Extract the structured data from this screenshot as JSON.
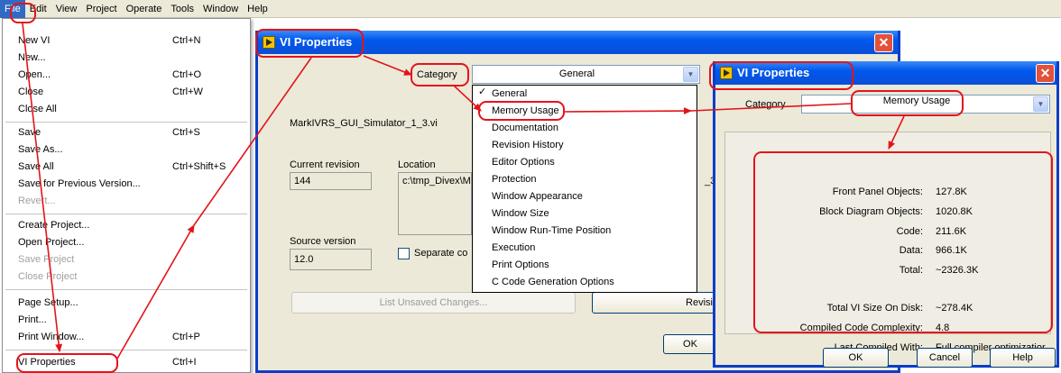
{
  "menubar": [
    "File",
    "Edit",
    "View",
    "Project",
    "Operate",
    "Tools",
    "Window",
    "Help"
  ],
  "file_menu": [
    {
      "label": "New VI",
      "shortcut": "Ctrl+N"
    },
    {
      "label": "New...",
      "shortcut": ""
    },
    {
      "label": "Open...",
      "shortcut": "Ctrl+O"
    },
    {
      "label": "Close",
      "shortcut": "Ctrl+W"
    },
    {
      "label": "Close All",
      "shortcut": ""
    },
    {
      "label": "Save",
      "shortcut": "Ctrl+S"
    },
    {
      "label": "Save As...",
      "shortcut": ""
    },
    {
      "label": "Save All",
      "shortcut": "Ctrl+Shift+S"
    },
    {
      "label": "Save for Previous Version...",
      "shortcut": ""
    },
    {
      "label": "Revert...",
      "shortcut": "",
      "disabled": true
    },
    {
      "label": "Create Project...",
      "shortcut": ""
    },
    {
      "label": "Open Project...",
      "shortcut": ""
    },
    {
      "label": "Save Project",
      "shortcut": "",
      "disabled": true
    },
    {
      "label": "Close Project",
      "shortcut": "",
      "disabled": true
    },
    {
      "label": "Page Setup...",
      "shortcut": ""
    },
    {
      "label": "Print...",
      "shortcut": ""
    },
    {
      "label": "Print Window...",
      "shortcut": "Ctrl+P"
    },
    {
      "label": "VI Properties",
      "shortcut": "Ctrl+I"
    }
  ],
  "dialog1": {
    "title": "VI Properties",
    "category_label": "Category",
    "category_value": "General",
    "vi_name": "MarkIVRS_GUI_Simulator_1_3.vi",
    "current_revision_label": "Current revision",
    "current_revision": "144",
    "location_label": "Location",
    "location_value": "c:\\tmp_Divex\\M",
    "location_tail": "_3",
    "source_version_label": "Source version",
    "source_version": "12.0",
    "separate_label": "Separate co",
    "list_unsaved": "List Unsaved Changes...",
    "revision_btn": "Revisi",
    "ok": "OK"
  },
  "category_options": [
    "General",
    "Memory Usage",
    "Documentation",
    "Revision History",
    "Editor Options",
    "Protection",
    "Window Appearance",
    "Window Size",
    "Window Run-Time Position",
    "Execution",
    "Print Options",
    "C Code Generation Options"
  ],
  "dialog2": {
    "title": "VI Properties",
    "category_label": "Category",
    "category_value": "Memory Usage",
    "stats": [
      {
        "label": "Front Panel Objects:",
        "value": "127.8K"
      },
      {
        "label": "Block Diagram Objects:",
        "value": "1020.8K"
      },
      {
        "label": "Code:",
        "value": "211.6K"
      },
      {
        "label": "Data:",
        "value": "966.1K"
      },
      {
        "label": "Total:",
        "value": "~2326.3K"
      }
    ],
    "stats2": [
      {
        "label": "Total VI Size On Disk:",
        "value": "~278.4K"
      },
      {
        "label": "Compiled Code Complexity:",
        "value": "4.8"
      },
      {
        "label": "Last Compiled With:",
        "value": "Full compiler optimizatior"
      }
    ],
    "ok": "OK",
    "cancel": "Cancel",
    "help": "Help"
  },
  "colors": {
    "annotation": "#e3141a",
    "titlebar": "#0058ee",
    "menu_highlight": "#316ac5"
  },
  "icons": [
    "close-icon",
    "vi-icon",
    "chevron-down-icon",
    "check-icon"
  ]
}
